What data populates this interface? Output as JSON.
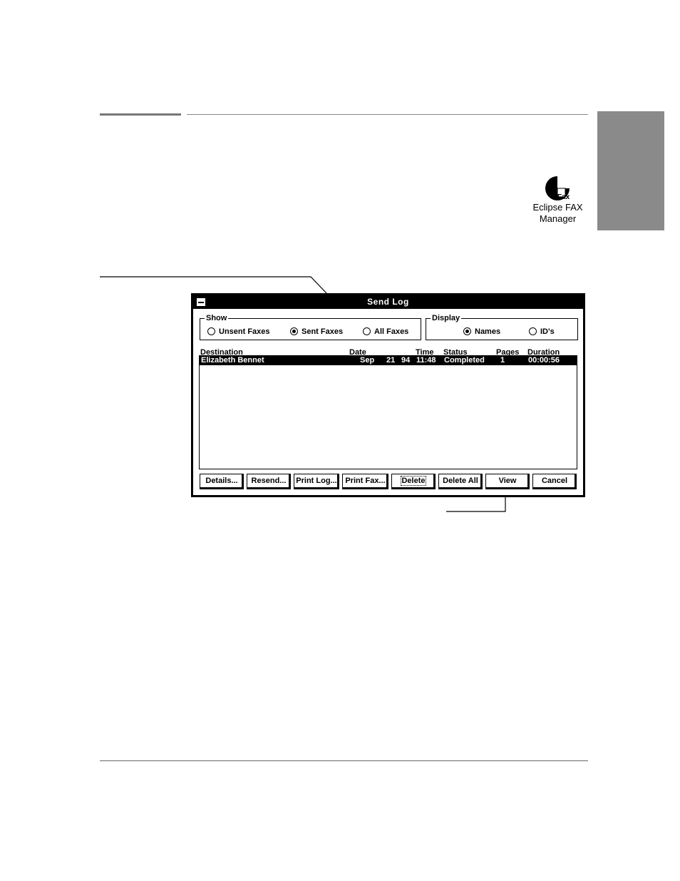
{
  "icon": {
    "name": "fax-icon",
    "badge": "Fax",
    "label_line1": "Eclipse FAX",
    "label_line2": "Manager"
  },
  "window": {
    "title": "Send Log",
    "show_group": {
      "title": "Show",
      "options": [
        {
          "label": "Unsent Faxes",
          "checked": false
        },
        {
          "label": "Sent Faxes",
          "checked": true
        },
        {
          "label": "All Faxes",
          "checked": false
        }
      ]
    },
    "display_group": {
      "title": "Display",
      "options": [
        {
          "label": "Names",
          "checked": true
        },
        {
          "label": "ID's",
          "checked": false
        }
      ]
    },
    "columns": {
      "destination": "Destination",
      "date": "Date",
      "time": "Time",
      "status": "Status",
      "pages": "Pages",
      "duration": "Duration"
    },
    "rows": [
      {
        "destination": "Elizabeth Bennet",
        "date_month": "Sep",
        "date_day": "21",
        "date_year": "94",
        "time": "11:48",
        "status": "Completed",
        "pages": "1",
        "duration": "00:00:56"
      }
    ],
    "buttons": {
      "details": "Details...",
      "resend": "Resend...",
      "print_log": "Print Log...",
      "print_fax": "Print Fax...",
      "delete": "Delete",
      "delete_all": "Delete All",
      "view": "View",
      "cancel": "Cancel"
    }
  }
}
